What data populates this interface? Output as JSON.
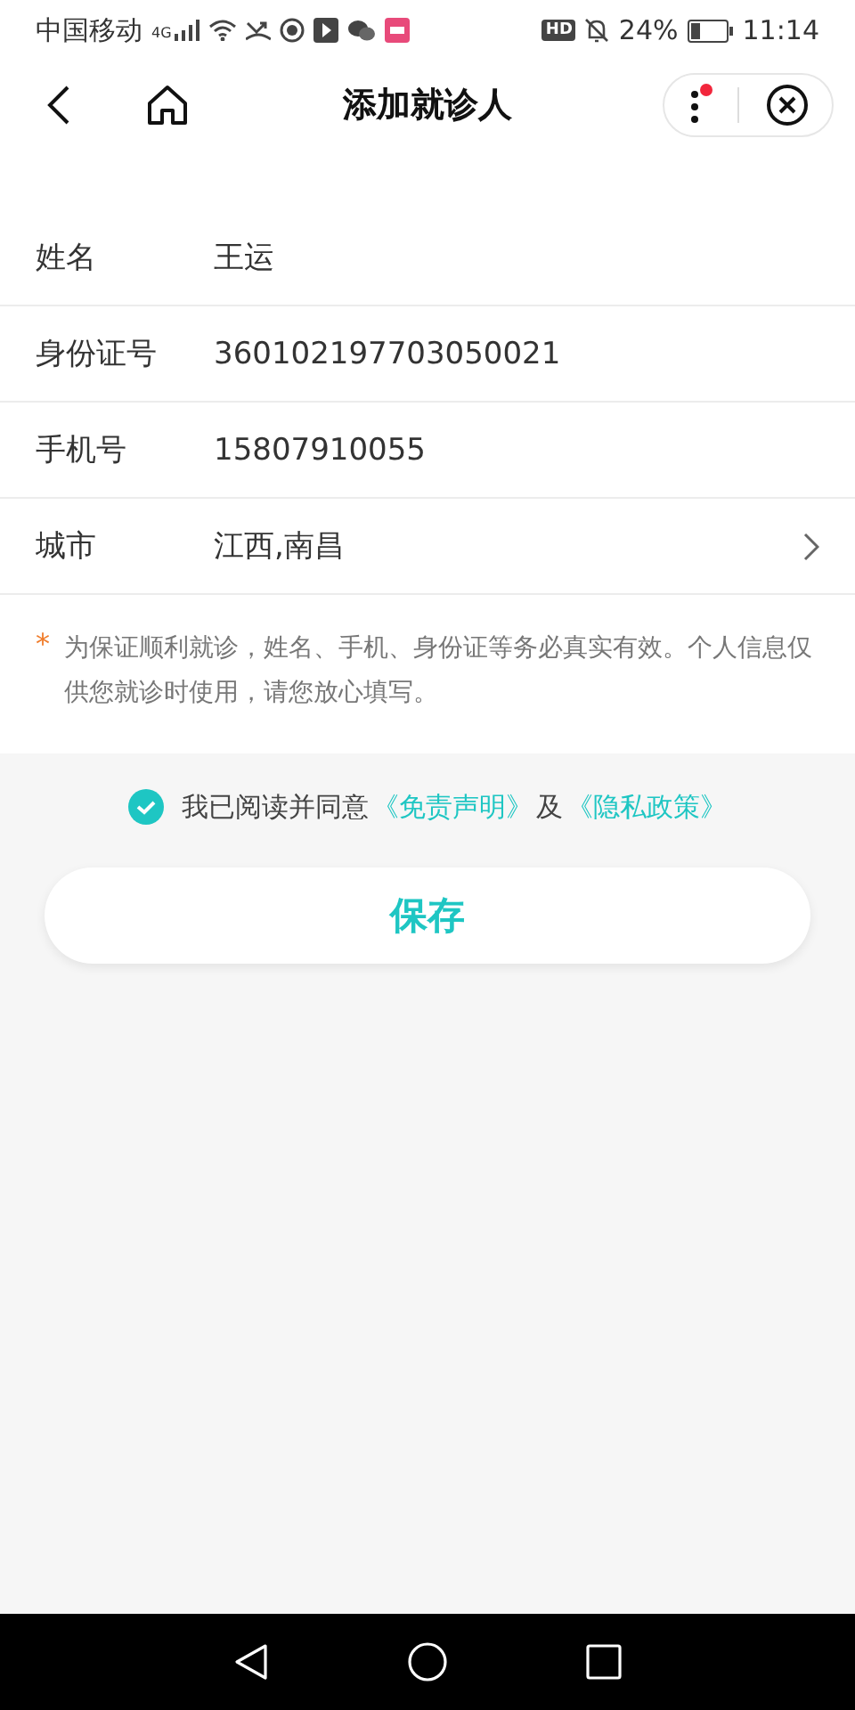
{
  "status_bar": {
    "carrier": "中国移动",
    "network": "4G",
    "hd": "HD",
    "battery": "24%",
    "time": "11:14"
  },
  "header": {
    "title": "添加就诊人",
    "menu_badge": true
  },
  "form": [
    {
      "label": "姓名",
      "value": "王运",
      "kind": "text"
    },
    {
      "label": "身份证号",
      "value": "360102197703050021",
      "kind": "text"
    },
    {
      "label": "手机号",
      "value": "15807910055",
      "kind": "text"
    },
    {
      "label": "城市",
      "value": "江西,南昌",
      "kind": "select"
    }
  ],
  "notice": {
    "mark": "*",
    "text": "为保证顺利就诊，姓名、手机、身份证等务必真实有效。个人信息仅供您就诊时使用，请您放心填写。"
  },
  "agreement": {
    "checked": true,
    "text": "我已阅读并同意",
    "link_1": "《免责声明》",
    "joiner": "及",
    "link_2": "《隐私政策》"
  },
  "save_button": "保存"
}
